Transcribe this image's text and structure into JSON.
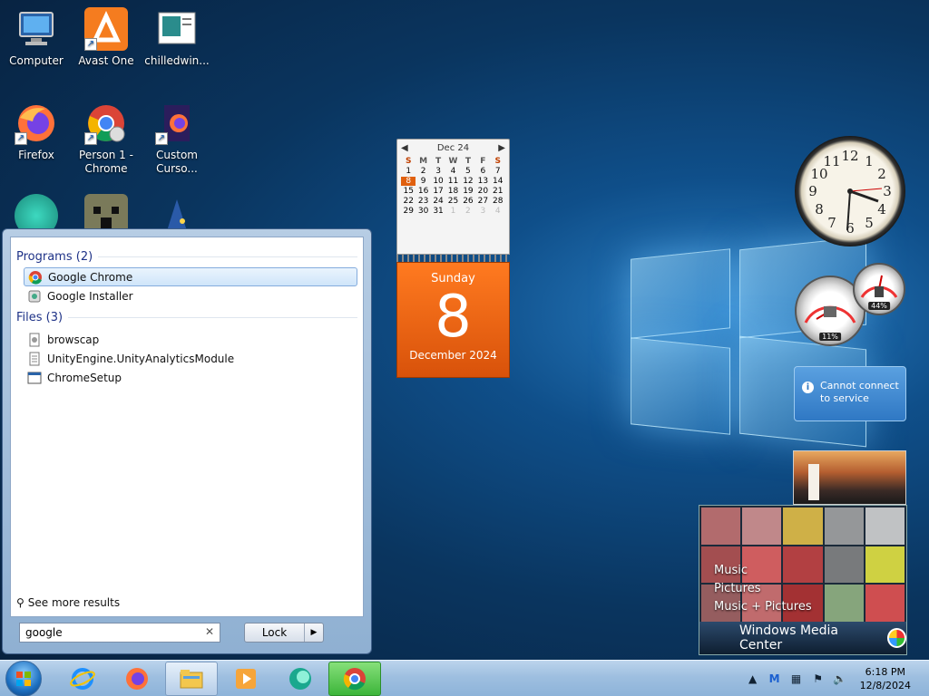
{
  "desktop": {
    "icons": [
      {
        "label": "Computer",
        "icon": "computer-icon"
      },
      {
        "label": "Avast One",
        "icon": "avast-icon"
      },
      {
        "label": "chilledwin...",
        "icon": "document-icon"
      },
      {
        "label": "Firefox",
        "icon": "firefox-icon"
      },
      {
        "label": "Person 1 - Chrome",
        "icon": "chrome-icon"
      },
      {
        "label": "Custom Curso...",
        "icon": "firefox-nightly-icon"
      }
    ]
  },
  "calendar": {
    "month_label": "Dec 24",
    "day_headers": [
      "S",
      "M",
      "T",
      "W",
      "T",
      "F",
      "S"
    ],
    "weeks": [
      [
        "1",
        "2",
        "3",
        "4",
        "5",
        "6",
        "7"
      ],
      [
        "8",
        "9",
        "10",
        "11",
        "12",
        "13",
        "14"
      ],
      [
        "15",
        "16",
        "17",
        "18",
        "19",
        "20",
        "21"
      ],
      [
        "22",
        "23",
        "24",
        "25",
        "26",
        "27",
        "28"
      ],
      [
        "29",
        "30",
        "31",
        "1",
        "2",
        "3",
        "4"
      ]
    ],
    "today": "8",
    "weekday": "Sunday",
    "day_number": "8",
    "month_year": "December 2024"
  },
  "cpu_meter": {
    "cpu": "11%",
    "memory": "44%"
  },
  "info_gadget": {
    "text": "Cannot connect to service"
  },
  "media_center": {
    "menu": [
      "Music",
      "Pictures",
      "Music + Pictures"
    ],
    "title": "Windows Media Center"
  },
  "start_menu": {
    "programs_header": "Programs (2)",
    "programs": [
      "Google Chrome",
      "Google Installer"
    ],
    "files_header": "Files (3)",
    "files": [
      "browscap",
      "UnityEngine.UnityAnalyticsModule",
      "ChromeSetup"
    ],
    "see_more": "See more results",
    "search_value": "google",
    "lock_label": "Lock"
  },
  "taskbar": {
    "time": "6:18 PM",
    "date": "12/8/2024",
    "pinned": [
      "internet-explorer-icon",
      "firefox-icon",
      "file-explorer-icon",
      "media-player-icon",
      "app-icon",
      "chrome-icon"
    ]
  },
  "colors": {
    "accent": "#e0600f",
    "taskbar": "#9ebfe0",
    "selection": "#cfe5fa"
  }
}
